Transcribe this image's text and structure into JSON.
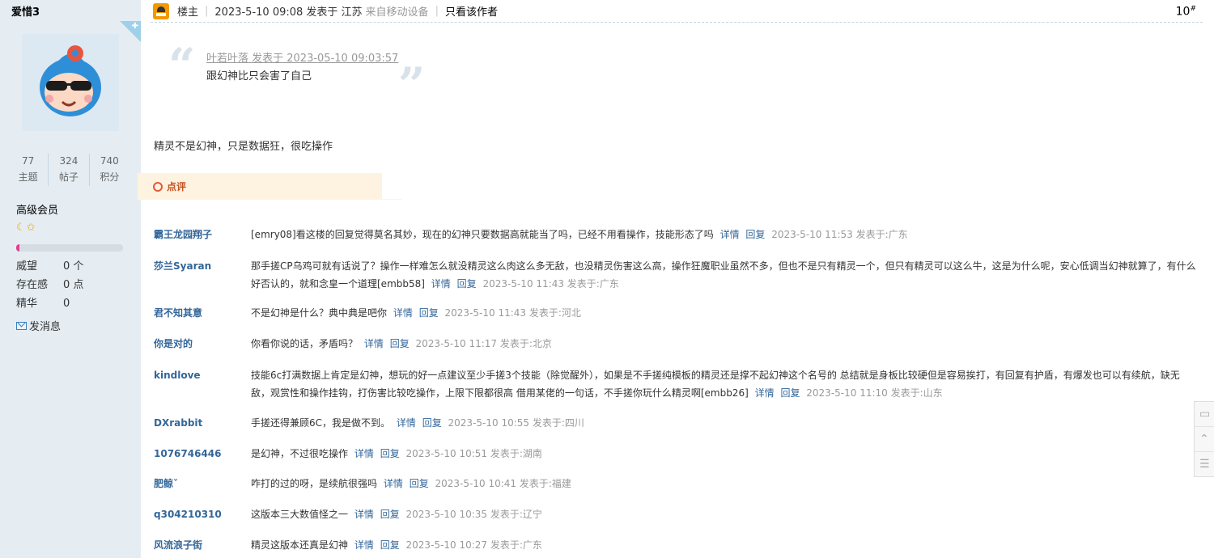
{
  "sidebar": {
    "username": "爱惜3",
    "stats": [
      {
        "num": "77",
        "label": "主题"
      },
      {
        "num": "324",
        "label": "帖子"
      },
      {
        "num": "740",
        "label": "积分"
      }
    ],
    "level_name": "高级会员",
    "level_stars": "☾✩",
    "progress_fraction": 0.03,
    "attrs": [
      {
        "key": "威望",
        "value": "0 个"
      },
      {
        "key": "存在感",
        "value": "0 点"
      },
      {
        "key": "精华",
        "value": "0"
      }
    ],
    "pm_label": "发消息",
    "colors": {
      "bg": "#e5edf2",
      "progress": "#e03f8e"
    }
  },
  "post": {
    "role": "楼主",
    "posted_at": "2023-5-10 09:08 发表于 江苏",
    "source": "来自移动设备",
    "only_author": "只看该作者",
    "floor": "10",
    "floor_mark": "#",
    "quote": {
      "meta": "叶若叶落 发表于 2023-05-10 09:03:57",
      "text": "跟幻神比只会害了自己"
    },
    "content": "精灵不是幻神，只是数据狂，很吃操作"
  },
  "comment_section": {
    "title": "点评",
    "detail_label": "详情",
    "reply_label": "回复",
    "comments": [
      {
        "author": "霸王龙园翔子",
        "text": "[emry08]看这楼的回复觉得莫名其妙，现在的幻神只要数据高就能当了吗，已经不用看操作，技能形态了吗",
        "time": "2023-5-10 11:53 发表于:广东"
      },
      {
        "author": "莎兰Syaran",
        "text": "那手搓CP乌鸡可就有话说了？操作一样难怎么就没精灵这么肉这么多无敌，也没精灵伤害这么高，操作狂魔职业虽然不多，但也不是只有精灵一个，但只有精灵可以这么牛，这是为什么呢，安心低调当幻神就算了，有什么好否认的，就和念皇一个道理[embb58]",
        "time": "2023-5-10 11:43 发表于:广东"
      },
      {
        "author": "君不知其意",
        "text": "不是幻神是什么？典中典是吧你",
        "time": "2023-5-10 11:43 发表于:河北"
      },
      {
        "author": "你是对的",
        "text": "你看你说的话，矛盾吗？",
        "time": "2023-5-10 11:17 发表于:北京"
      },
      {
        "author": "kindlove",
        "text": "技能6c打满数据上肯定是幻神，想玩的好一点建议至少手搓3个技能（除觉醒外），如果是不手搓纯模板的精灵还是撑不起幻神这个名号的 总结就是身板比较硬但是容易挨打，有回复有护盾，有爆发也可以有续航，缺无敌，观赏性和操作挂钩，打伤害比较吃操作，上限下限都很高 借用某佬的一句话，不手搓你玩什么精灵啊[embb26]",
        "time": "2023-5-10 11:10 发表于:山东"
      },
      {
        "author": "DXrabbit",
        "text": "手搓还得兼顾6C，我是做不到。",
        "time": "2023-5-10 10:55 发表于:四川"
      },
      {
        "author": "1076746446",
        "text": "是幻神，不过很吃操作",
        "time": "2023-5-10 10:51 发表于:湖南"
      },
      {
        "author": "肥鲸ˇ",
        "text": "咋打的过的呀，是续航很强吗",
        "time": "2023-5-10 10:41 发表于:福建"
      },
      {
        "author": "q304210310",
        "text": "这版本三大数值怪之一",
        "time": "2023-5-10 10:35 发表于:辽宁"
      },
      {
        "author": "风流浪子街",
        "text": "精灵这版本还真是幻神",
        "time": "2023-5-10 10:27 发表于:广东"
      }
    ]
  },
  "side_tools": [
    {
      "name": "comment-tool-icon",
      "glyph": "▭"
    },
    {
      "name": "back-to-top-icon",
      "glyph": "⌃"
    },
    {
      "name": "list-icon",
      "glyph": "☰"
    }
  ]
}
